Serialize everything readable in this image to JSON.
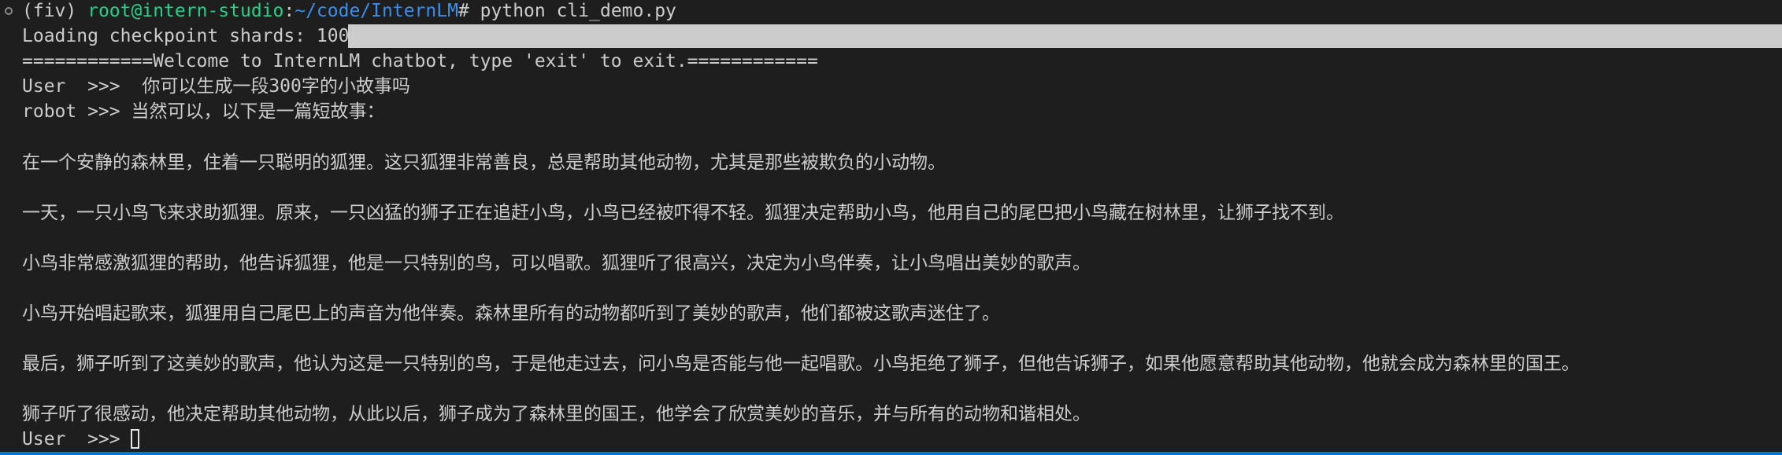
{
  "prompt": {
    "env": "(fiv)",
    "user_host": "root@intern-studio",
    "separator": ":",
    "path": "~/code/InternLM",
    "symbol": "#",
    "command": "python cli_demo.py"
  },
  "loading": {
    "text": "Loading checkpoint shards: 100%|",
    "progress": 1.0
  },
  "welcome": "============Welcome to InternLM chatbot, type 'exit' to exit.============",
  "user_label": "User  >>>",
  "user_message": "你可以生成一段300字的小故事吗",
  "robot_label": "robot >>>",
  "robot_intro": "当然可以，以下是一篇短故事：",
  "story": [
    "在一个安静的森林里，住着一只聪明的狐狸。这只狐狸非常善良，总是帮助其他动物，尤其是那些被欺负的小动物。",
    "一天，一只小鸟飞来求助狐狸。原来，一只凶猛的狮子正在追赶小鸟，小鸟已经被吓得不轻。狐狸决定帮助小鸟，他用自己的尾巴把小鸟藏在树林里，让狮子找不到。",
    "小鸟非常感激狐狸的帮助，他告诉狐狸，他是一只特别的鸟，可以唱歌。狐狸听了很高兴，决定为小鸟伴奏，让小鸟唱出美妙的歌声。",
    "小鸟开始唱起歌来，狐狸用自己尾巴上的声音为他伴奏。森林里所有的动物都听到了美妙的歌声，他们都被这歌声迷住了。",
    "最后，狮子听到了这美妙的歌声，他认为这是一只特别的鸟，于是他走过去，问小鸟是否能与他一起唱歌。小鸟拒绝了狮子，但他告诉狮子，如果他愿意帮助其他动物，他就会成为森林里的国王。",
    "狮子听了很感动，他决定帮助其他动物，从此以后，狮子成为了森林里的国王，他学会了欣赏美妙的音乐，并与所有的动物和谐相处。"
  ],
  "final_prompt": "User  >>>"
}
